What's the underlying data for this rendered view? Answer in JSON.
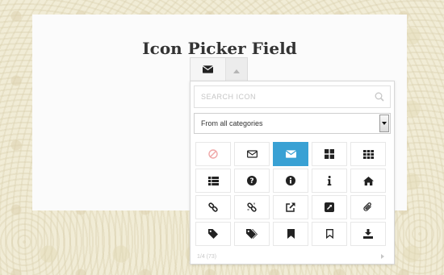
{
  "page": {
    "title": "Icon Picker Field"
  },
  "picker": {
    "selected_icon": "envelope-icon",
    "search": {
      "placeholder": "SEARCH ICON",
      "value": ""
    },
    "category_select": {
      "selected": "From all categories"
    },
    "icons": [
      {
        "name": "none-icon",
        "selected": false
      },
      {
        "name": "envelope-outline-icon",
        "selected": false
      },
      {
        "name": "envelope-icon",
        "selected": true
      },
      {
        "name": "th-large-icon",
        "selected": false
      },
      {
        "name": "th-icon",
        "selected": false
      },
      {
        "name": "th-list-icon",
        "selected": false
      },
      {
        "name": "question-circle-icon",
        "selected": false
      },
      {
        "name": "info-circle-icon",
        "selected": false
      },
      {
        "name": "info-icon",
        "selected": false
      },
      {
        "name": "home-icon",
        "selected": false
      },
      {
        "name": "link-icon",
        "selected": false
      },
      {
        "name": "unlink-icon",
        "selected": false
      },
      {
        "name": "external-link-icon",
        "selected": false
      },
      {
        "name": "external-link-square-icon",
        "selected": false
      },
      {
        "name": "paperclip-icon",
        "selected": false
      },
      {
        "name": "tag-icon",
        "selected": false
      },
      {
        "name": "tags-icon",
        "selected": false
      },
      {
        "name": "bookmark-icon",
        "selected": false
      },
      {
        "name": "bookmark-outline-icon",
        "selected": false
      },
      {
        "name": "download-icon",
        "selected": false
      }
    ],
    "pager": {
      "label": "1/4 (73)"
    },
    "colors": {
      "selected_bg": "#39a1d4",
      "none_icon": "#f0a8a8"
    }
  }
}
